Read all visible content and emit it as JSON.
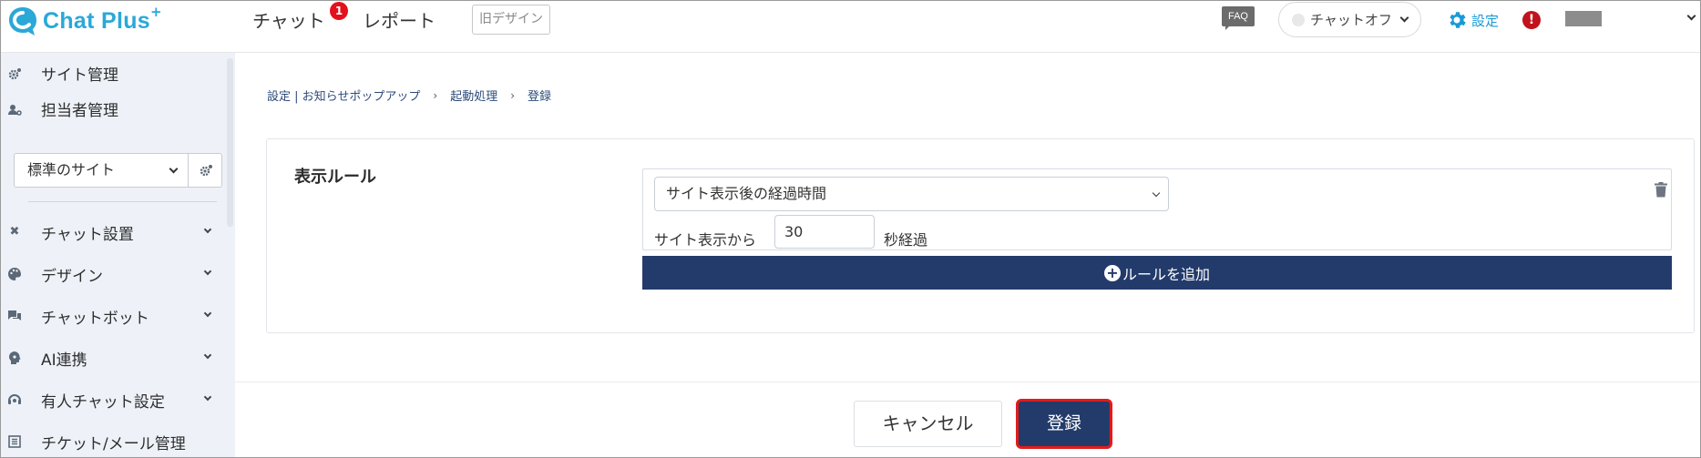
{
  "app": {
    "logo_text": "Chat Plus",
    "logo_plus": "+"
  },
  "header": {
    "nav": [
      {
        "label": "チャット",
        "badge": "1"
      },
      {
        "label": "レポート"
      }
    ],
    "old_design_label": "旧デザイン",
    "faq_label": "FAQ",
    "chat_status": "チャットオフ",
    "settings_label": "設定",
    "alert_symbol": "!",
    "colors": {
      "brand": "#2aa8d8",
      "badge": "#e3111c",
      "primary": "#233b6b"
    }
  },
  "sidebar": {
    "top_items": [
      {
        "label": "サイト管理",
        "icon": "gear-icon"
      },
      {
        "label": "担当者管理",
        "icon": "user-gear-icon"
      }
    ],
    "site_select": {
      "value": "標準のサイト"
    },
    "items": [
      {
        "label": "チャット設置",
        "icon": "tools-icon"
      },
      {
        "label": "デザイン",
        "icon": "palette-icon"
      },
      {
        "label": "チャットボット",
        "icon": "chat-bubbles-icon"
      },
      {
        "label": "AI連携",
        "icon": "ai-head-icon"
      },
      {
        "label": "有人チャット設定",
        "icon": "operator-icon"
      },
      {
        "label": "チケット/メール管理",
        "icon": "ticket-icon"
      }
    ]
  },
  "main": {
    "breadcrumb": {
      "item1": "設定 | お知らせポップアップ",
      "sep": "›",
      "item2": "起動処理",
      "item3": "登録"
    },
    "card": {
      "title": "表示ルール",
      "rule_type": "サイト表示後の経過時間",
      "rule_prefix": "サイト表示から",
      "rule_value": "30",
      "rule_suffix": "秒経過",
      "add_rule_label": "ルールを追加",
      "add_rule_symbol": "+"
    },
    "footer": {
      "cancel_label": "キャンセル",
      "submit_label": "登録"
    }
  }
}
